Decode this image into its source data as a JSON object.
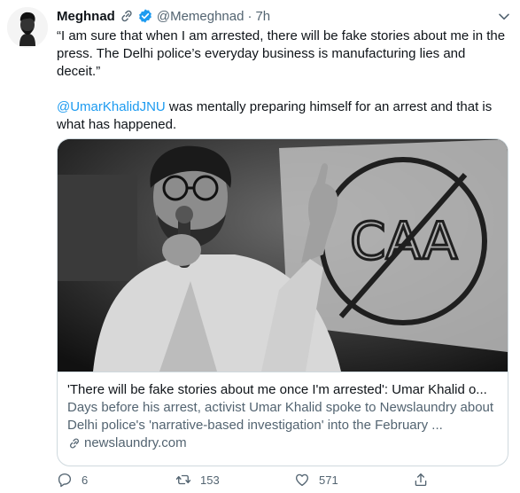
{
  "tweet": {
    "display_name": "Meghnad",
    "handle": "@Memeghnad",
    "separator": "·",
    "time": "7h",
    "text_quote": "“I am sure that when I am arrested, there will be fake stories about me in the press. The Delhi police’s everyday business is manufacturing lies and deceit.”",
    "mention": "@UmarKhalidJNU",
    "text_after_mention": " was mentally preparing himself for an arrest and that is what has happened."
  },
  "card": {
    "image_text": "CAA",
    "title": "'There will be fake stories about me once I'm arrested': Umar Khalid o...",
    "description": "Days before his arrest, activist Umar Khalid spoke to Newslaundry about Delhi police's 'narrative-based investigation' into the February ...",
    "domain": "newslaundry.com"
  },
  "actions": {
    "reply_count": "6",
    "retweet_count": "153",
    "like_count": "571"
  },
  "colors": {
    "accent": "#1d9bf0",
    "secondary_text": "#536471",
    "border": "#cfd9de"
  },
  "icons": [
    "link-icon",
    "verified-icon",
    "more-icon",
    "reply-icon",
    "retweet-icon",
    "like-icon",
    "share-icon"
  ]
}
